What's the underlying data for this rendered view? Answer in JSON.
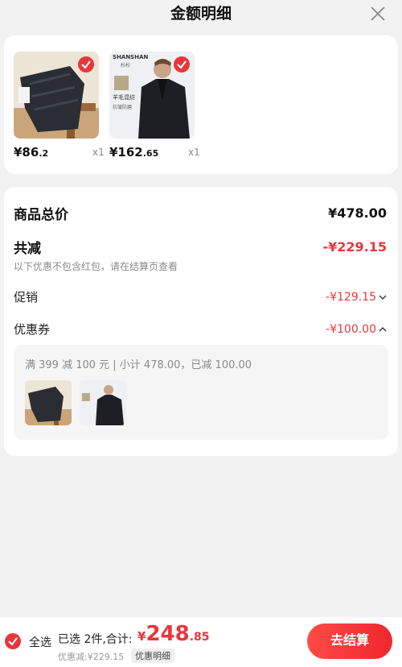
{
  "header": {
    "title": "金额明细"
  },
  "products": [
    {
      "price_int": "¥86",
      "price_dec": ".2",
      "qty": "x1"
    },
    {
      "price_int": "¥162",
      "price_dec": ".65",
      "qty": "x1",
      "brand": "SHANSHAN",
      "brand_cn": "杉杉",
      "tag1": "羊毛混纺",
      "tag2": "抗皱防磨"
    }
  ],
  "summary": {
    "total_label": "商品总价",
    "total_value": "¥478.00",
    "discount_label": "共减",
    "discount_value": "-¥229.15",
    "note": "以下优惠不包含红包，请在结算页查看",
    "promo_label": "促销",
    "promo_value": "-¥129.15",
    "coupon_label": "优惠券",
    "coupon_value": "-¥100.00",
    "coupon_desc": "满 399 减 100 元 | 小计 478.00，已减 100.00"
  },
  "bottom": {
    "select_all": "全选",
    "selected": "已选 2件,合计:",
    "total_sym": "¥",
    "total_int": "248",
    "total_dec": ".85",
    "saved": "优惠减:¥229.15",
    "detail_chip": "优惠明细",
    "pay_button": "去结算"
  },
  "colors": {
    "accent": "#e8373b",
    "background": "#f2f2f2"
  },
  "icons": {
    "close": "close-icon",
    "check": "check-circle-icon",
    "chevron_down": "chevron-down-icon",
    "chevron_up": "chevron-up-icon"
  }
}
